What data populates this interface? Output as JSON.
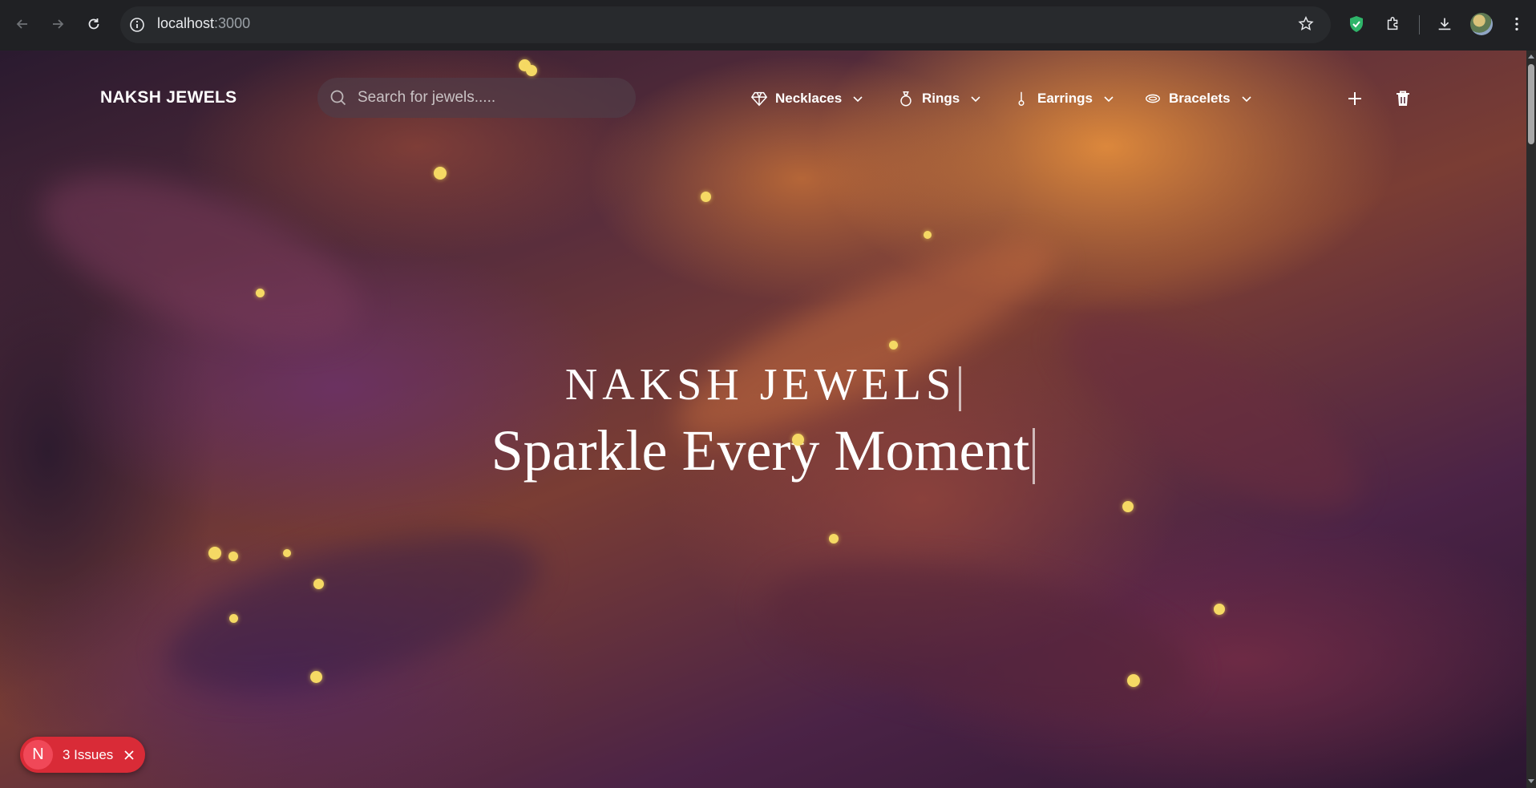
{
  "browser": {
    "url_host": "localhost",
    "url_port": ":3000"
  },
  "header": {
    "brand": "NAKSH JEWELS",
    "search_placeholder": "Search for jewels.....",
    "menu": [
      {
        "label": "Necklaces",
        "icon": "diamond-icon"
      },
      {
        "label": "Rings",
        "icon": "ring-icon"
      },
      {
        "label": "Earrings",
        "icon": "earring-icon"
      },
      {
        "label": "Bracelets",
        "icon": "bracelet-icon"
      }
    ]
  },
  "hero": {
    "title": "NAKSH JEWELS",
    "subtitle": "Sparkle Every Moment"
  },
  "dev_overlay": {
    "badge_letter": "N",
    "issues_label": "3 Issues"
  },
  "colors": {
    "accent_gold": "#f5d964",
    "issues_red": "#d92b37"
  }
}
